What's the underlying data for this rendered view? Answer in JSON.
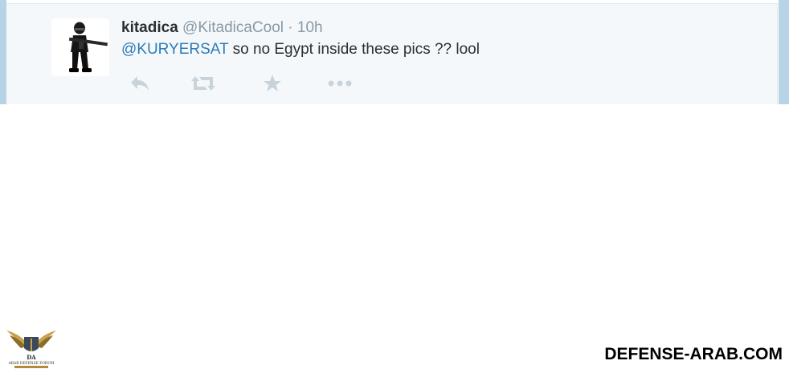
{
  "tweet": {
    "fullname": "kitadica",
    "username": "@KitadicaCool",
    "separator": "·",
    "time": "10h",
    "mention": "@KURYERSAT",
    "text": " so no Egypt inside these pics ?? lool",
    "actions": [
      {
        "name": "reply",
        "icon": "reply-icon"
      },
      {
        "name": "retweet",
        "icon": "retweet-icon"
      },
      {
        "name": "favorite",
        "icon": "star-icon"
      },
      {
        "name": "more",
        "icon": "more-dots-icon"
      }
    ]
  },
  "watermark": {
    "logo_text": "ARAB DEFENSE FORUM",
    "logo_mark": "DA",
    "brand": "DEFENSE-ARAB.COM"
  },
  "colors": {
    "card_bg": "#f5f8fa",
    "page_accent": "#b7d3e6",
    "link": "#2b7bb9",
    "muted": "#8899a6",
    "icon": "#c8d3da"
  }
}
